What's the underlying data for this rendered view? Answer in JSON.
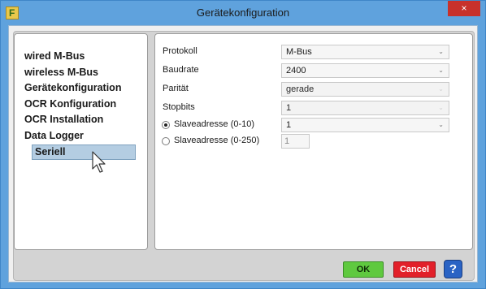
{
  "window": {
    "title": "Gerätekonfiguration",
    "close_label": "×"
  },
  "sidebar": {
    "items": [
      {
        "label": "wired M-Bus"
      },
      {
        "label": "wireless M-Bus"
      },
      {
        "label": "Gerätekonfiguration"
      },
      {
        "label": "OCR Konfiguration"
      },
      {
        "label": "OCR Installation"
      },
      {
        "label": "Data Logger"
      },
      {
        "label": "Seriell",
        "selected": true
      }
    ]
  },
  "settings": {
    "protokoll": {
      "label": "Protokoll",
      "value": "M-Bus"
    },
    "baudrate": {
      "label": "Baudrate",
      "value": "2400"
    },
    "paritaet": {
      "label": "Parität",
      "value": "gerade",
      "disabled": true
    },
    "stopbits": {
      "label": "Stopbits",
      "value": "1",
      "disabled": true
    },
    "slave_small": {
      "label": "Slaveadresse (0-10)",
      "value": "1",
      "checked": true
    },
    "slave_large": {
      "label": "Slaveadresse (0-250)",
      "value": "1",
      "checked": false
    }
  },
  "buttons": {
    "ok": "OK",
    "cancel": "Cancel",
    "help": "?"
  },
  "colors": {
    "title_bar": "#5fa2dd",
    "ok": "#5fc93f",
    "cancel": "#e2202a",
    "help": "#2a63c4",
    "selection": "#b4cde2"
  }
}
